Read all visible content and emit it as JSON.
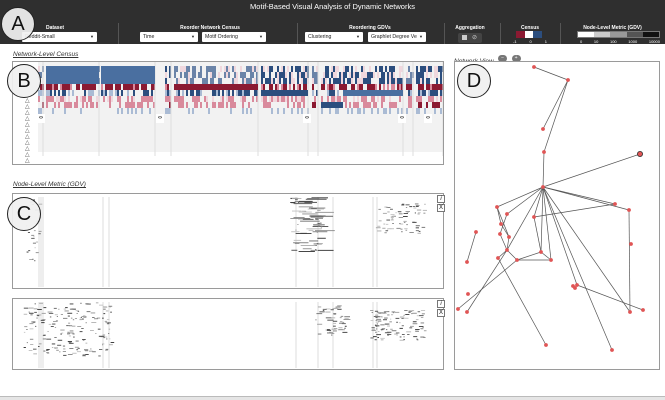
{
  "app": {
    "title": "Motif-Based Visual Analysis of Dynamic Networks"
  },
  "controls": {
    "dataset": {
      "label": "Dataset",
      "value": "Reddit-Small"
    },
    "reorder_census": {
      "label": "Reorder Network Census",
      "value_1": "Time",
      "value_2": "Motif Ordering"
    },
    "reorder_gdv": {
      "label": "Reordering GDVs",
      "value_1": "Clustering",
      "value_2": "Graphlet Degree Ve"
    },
    "aggregation": {
      "label": "Aggregation"
    },
    "census": {
      "label": "Census",
      "ticks": [
        "-1",
        "0",
        "1"
      ],
      "colors": [
        "#8b1a32",
        "#ffffff",
        "#2c4e7e"
      ]
    },
    "node_metric": {
      "label": "Node-Level Metric (GDV)",
      "ticks": [
        "0",
        "10",
        "100",
        "1000",
        "10000"
      ]
    }
  },
  "panels": {
    "network_census": {
      "title": "Network-Level Census",
      "scroll_left": "‹",
      "scroll_right": "›"
    },
    "node_metric": {
      "title": "Node-Level Metric (GDV)",
      "info_btn": "i",
      "close_btn": "X"
    },
    "network_view": {
      "title": "Network View"
    }
  },
  "annotations": [
    "A",
    "B",
    "C",
    "D"
  ],
  "colors": {
    "header_bg": "#2f2f2f",
    "red": "#8b1a32",
    "blue": "#2c4e7e",
    "node": "#e05555"
  }
}
